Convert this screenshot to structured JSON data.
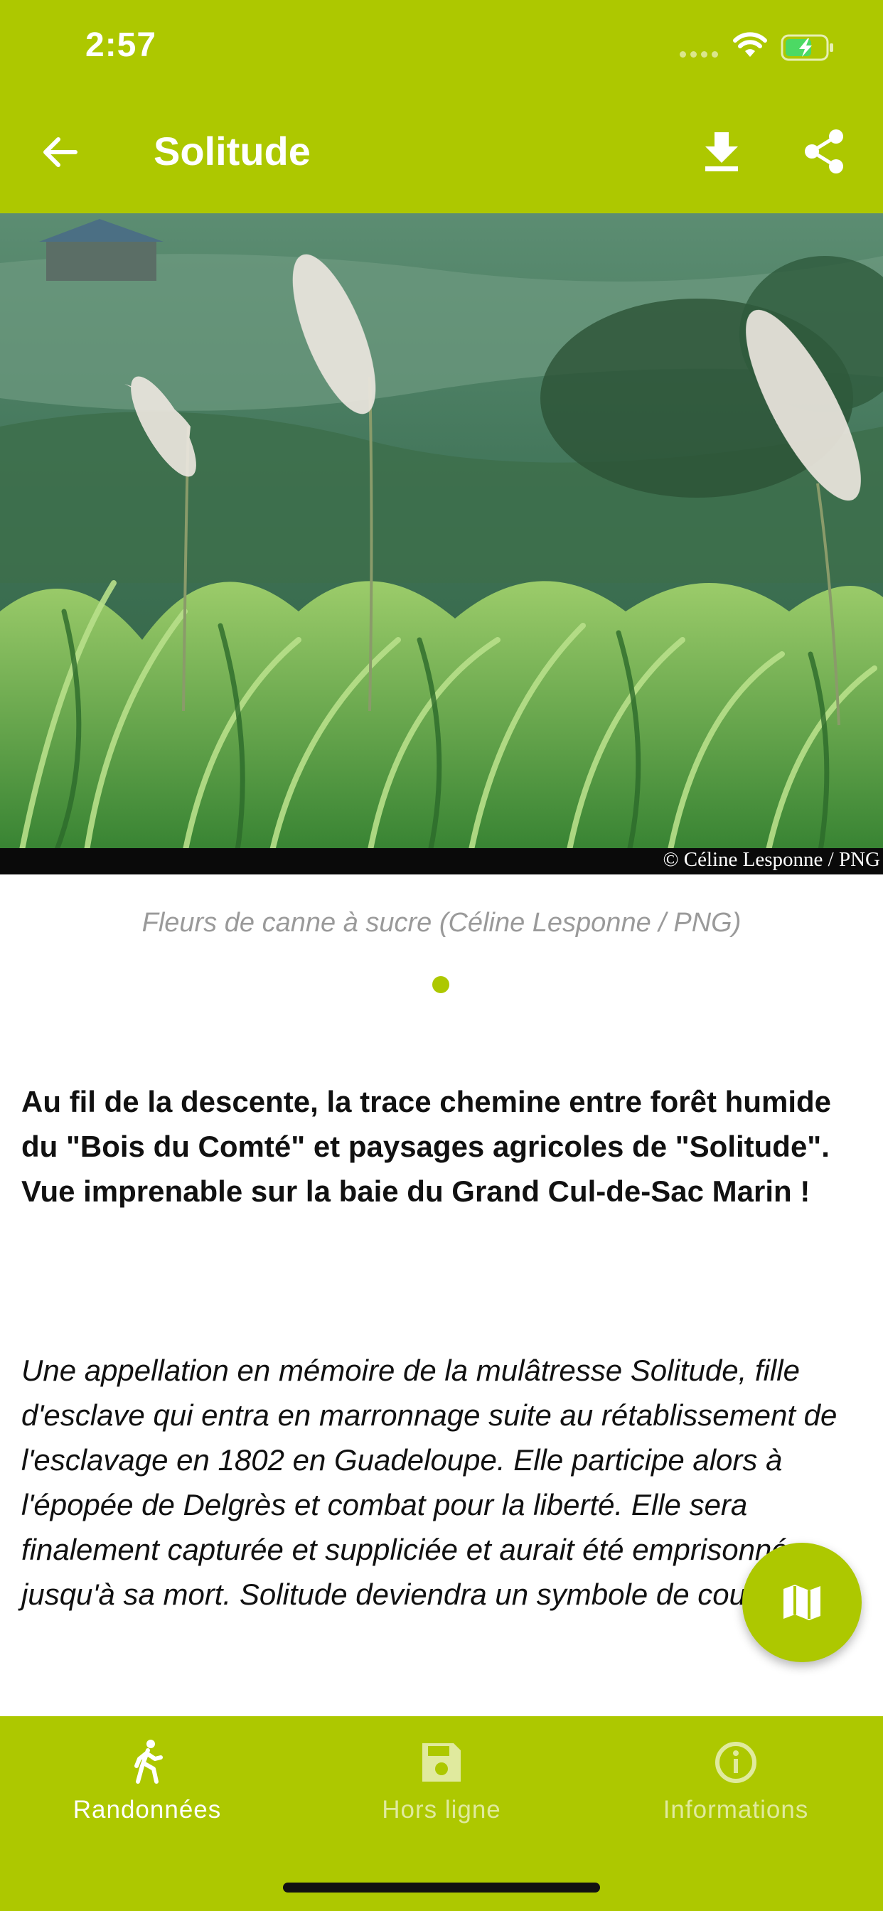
{
  "status_bar": {
    "time": "2:57"
  },
  "header": {
    "title": "Solitude"
  },
  "gallery": {
    "photo_credit": "© Céline Lesponne / PNG",
    "caption": "Fleurs de canne à sucre (Céline Lesponne / PNG)"
  },
  "content": {
    "intro": "Au fil de la descente, la trace chemine entre forêt humide du \"Bois du Comté\" et paysages agricoles de \"Solitude\". Vue imprenable sur la baie du Grand Cul-de-Sac Marin !",
    "story": "Une appellation en mémoire de la mulâtresse Solitude, fille d'esclave qui entra en marronnage suite au rétablissement de l'esclavage en 1802 en Guadeloupe. Elle participe alors à l'épopée de Delgrès et combat pour la liberté. Elle sera finalement capturée et suppliciée et aurait été emprisonnée jusqu'à sa mort. Solitude deviendra un symbole de courage."
  },
  "tabs": [
    {
      "label": "Randonnées",
      "icon": "hiking-icon",
      "active": true
    },
    {
      "label": "Hors ligne",
      "icon": "save-icon",
      "active": false
    },
    {
      "label": "Informations",
      "icon": "info-icon",
      "active": false
    }
  ],
  "colors": {
    "accent": "#adc800",
    "text": "#111111",
    "caption": "#9a9a9a"
  }
}
